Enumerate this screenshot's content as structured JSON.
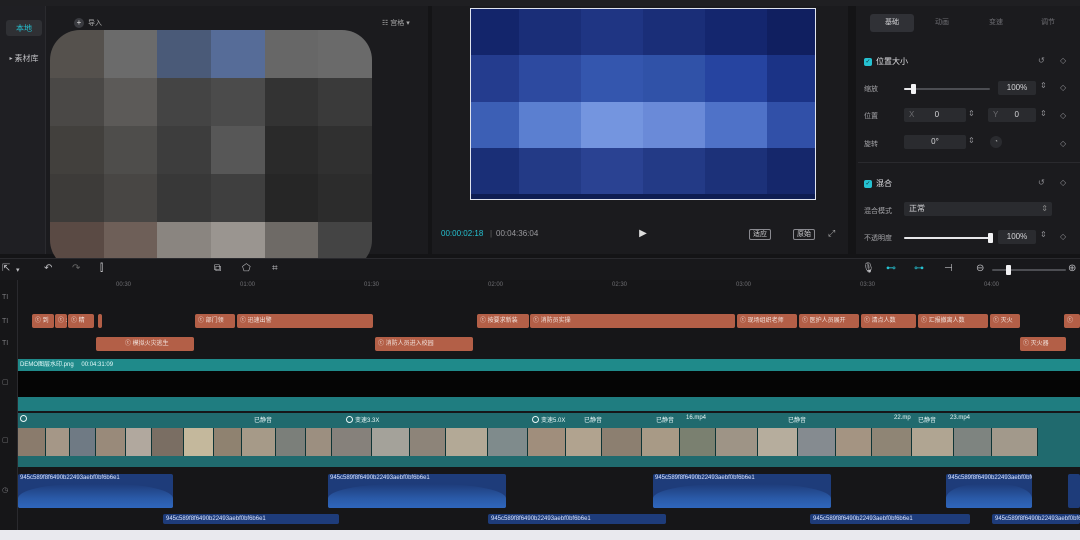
{
  "media": {
    "side_local": "本地",
    "side_library": "素材库",
    "import_label": "导入",
    "sort_label": "宫格"
  },
  "player": {
    "time_current": "00:00:02:18",
    "time_total": "00:04:36:04",
    "btn_fit": "适应",
    "btn_original": "原始"
  },
  "props": {
    "tabs": [
      "基础",
      "动画",
      "变速",
      "调节"
    ],
    "section_position": "位置大小",
    "scale_label": "缩放",
    "scale_value": "100%",
    "scale_level": 0.1,
    "position_label": "位置",
    "x_label": "X",
    "x_value": "0",
    "y_label": "Y",
    "y_value": "0",
    "rotate_label": "旋转",
    "rotate_value": "0°",
    "section_blend": "混合",
    "blend_mode_label": "混合模式",
    "blend_mode_value": "正常",
    "opacity_label": "不透明度",
    "opacity_value": "100%",
    "opacity_level": 1.0
  },
  "ruler": [
    "00:30",
    "01:00",
    "01:30",
    "02:00",
    "02:30",
    "03:00",
    "03:30",
    "04:00"
  ],
  "tracks": {
    "text_row1": [
      {
        "label": "ⓣ 到"
      },
      {
        "label": "ⓣ 乡"
      },
      {
        "label": "ⓣ 精"
      },
      {
        "label": "ⓣ 部门领"
      },
      {
        "label": "ⓣ 迅速出警"
      },
      {
        "label": "ⓣ 按要求新装"
      },
      {
        "label": "ⓣ 消防员实操"
      },
      {
        "label": "ⓣ 现场组织老师"
      },
      {
        "label": "ⓣ 医护人员展开"
      },
      {
        "label": "ⓣ 清点人数"
      },
      {
        "label": "ⓣ 汇报撤离人数"
      },
      {
        "label": "ⓣ 灭火"
      },
      {
        "label": "ⓣ"
      }
    ],
    "text_row2": [
      {
        "label": "ⓣ 模拟火灾逃生"
      },
      {
        "label": "ⓣ 消防人员进入校园"
      },
      {
        "label": "ⓣ 灭火器"
      }
    ],
    "sticker_label": "DEMO图层水印.png",
    "sticker_duration": "00:04:31:09",
    "video_labels": [
      "变速3.3X",
      "变速5.0X",
      "16.mp4",
      "22.mp",
      "23.mp4"
    ],
    "video_tag_muted": "已静音",
    "audio_name": "945c589f8f6490b22493aebf0bf6b6e1"
  }
}
